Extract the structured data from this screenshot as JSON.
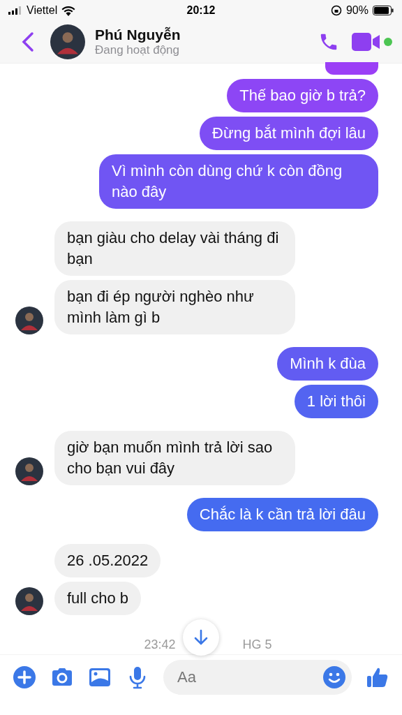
{
  "status_bar": {
    "carrier": "Viettel",
    "time": "20:12",
    "battery": "90%"
  },
  "header": {
    "name": "Phú Nguyễn",
    "status": "Đang hoạt động",
    "online": true
  },
  "groups": [
    {
      "kind": "sent",
      "messages": [
        {
          "kind": "cut"
        },
        {
          "kind": "text",
          "text": "Thế bao giờ b trả?"
        },
        {
          "kind": "text",
          "text": "Đừng bắt mình đợi lâu"
        },
        {
          "kind": "text",
          "text": "Vì mình còn dùng chứ k còn đồng nào đây"
        }
      ]
    },
    {
      "kind": "received",
      "messages": [
        {
          "kind": "text",
          "text": "bạn giàu cho delay vài tháng đi bạn"
        },
        {
          "kind": "text",
          "text": "bạn đi ép người nghèo như mình làm gì b"
        }
      ]
    },
    {
      "kind": "sent",
      "messages": [
        {
          "kind": "text",
          "text": "Mình k đùa"
        },
        {
          "kind": "text",
          "text": "1 lời thôi"
        }
      ]
    },
    {
      "kind": "received",
      "messages": [
        {
          "kind": "text",
          "text": "giờ bạn muốn mình trả lời sao cho bạn vui đây"
        }
      ]
    },
    {
      "kind": "sent",
      "messages": [
        {
          "kind": "text",
          "text": "Chắc là k cần trả lời đâu"
        }
      ]
    },
    {
      "kind": "received",
      "messages": [
        {
          "kind": "text",
          "text": "26 .05.2022"
        },
        {
          "kind": "text",
          "text": "full cho b"
        }
      ]
    }
  ],
  "timestamp": [
    "23:42",
    "HG 5"
  ],
  "composer": {
    "placeholder": "Aa"
  }
}
